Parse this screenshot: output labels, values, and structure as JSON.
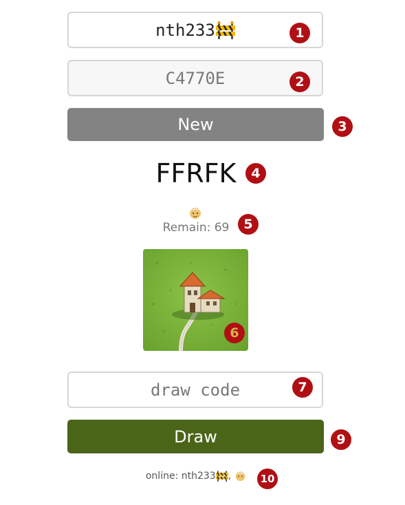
{
  "username_field": {
    "value": "nth233",
    "icon": "construction-barrier-icon"
  },
  "room_code_field": {
    "value": "C4770E"
  },
  "new_button": {
    "label": "New",
    "color": "#838383"
  },
  "game_code": {
    "text": "FFRFK"
  },
  "player_indicator": {
    "icon": "old-man-face-icon"
  },
  "remaining": {
    "text": "Remain: 69"
  },
  "tile": {
    "name": "tile-card",
    "colors": {
      "grass": "#7fb53c",
      "roof": "#d86a30",
      "wall": "#e6dcc2"
    }
  },
  "draw_code_field": {
    "placeholder": "draw code",
    "value": ""
  },
  "draw_button": {
    "label": "Draw",
    "color": "#4b6518"
  },
  "online": {
    "text": "online: nth233",
    "separator": ",",
    "icons": [
      "construction-barrier-icon",
      "old-man-face-icon"
    ]
  },
  "markers": [
    "1",
    "2",
    "3",
    "4",
    "5",
    "6",
    "7",
    "9",
    "10"
  ],
  "accent_colors": {
    "marker": "#b00f14"
  }
}
